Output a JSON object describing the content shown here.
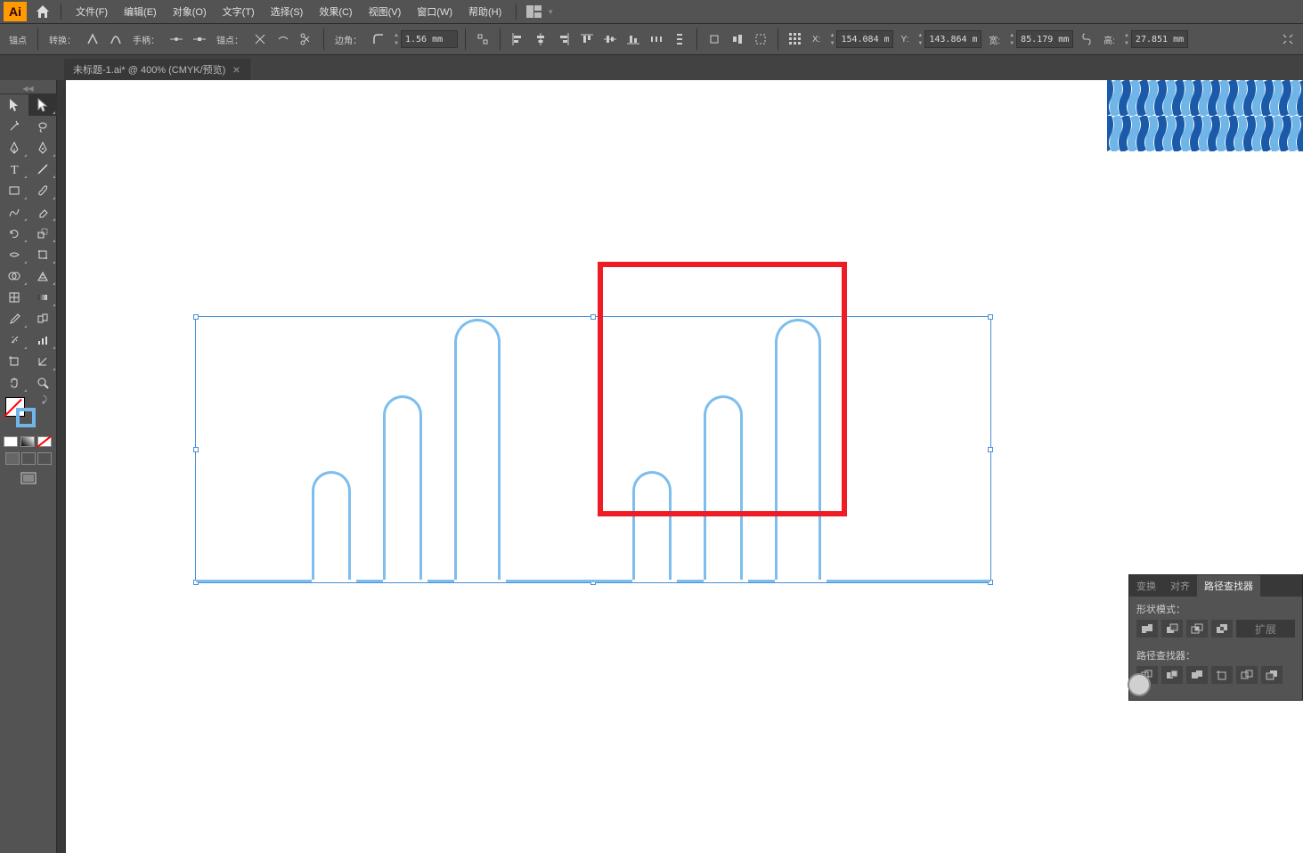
{
  "app": {
    "logo": "Ai"
  },
  "menu": {
    "file": "文件(F)",
    "edit": "编辑(E)",
    "object": "对象(O)",
    "type": "文字(T)",
    "select": "选择(S)",
    "effect": "效果(C)",
    "view": "视图(V)",
    "window": "窗口(W)",
    "help": "帮助(H)"
  },
  "control": {
    "anchor_label": "锚点",
    "convert_label": "转换：",
    "handle_label": "手柄：",
    "anchor_pt_label": "锚点：",
    "corner_label": "边角：",
    "corner_val": "1.56 mm",
    "x_label": "X:",
    "x_val": "154.084 m",
    "y_label": "Y:",
    "y_val": "143.864 m",
    "w_label": "宽:",
    "w_val": "85.179 mm",
    "h_label": "高:",
    "h_val": "27.851 mm"
  },
  "tab": {
    "title": "未标题-1.ai* @ 400% (CMYK/预览)"
  },
  "panel": {
    "tab_transform": "变换",
    "tab_align": "对齐",
    "tab_pathfinder": "路径查找器",
    "shape_mode": "形状模式：",
    "pathfinder": "路径查找器：",
    "expand": "扩展"
  },
  "colors": {
    "stroke": "#7ebeee",
    "highlight": "#ee1c25"
  }
}
